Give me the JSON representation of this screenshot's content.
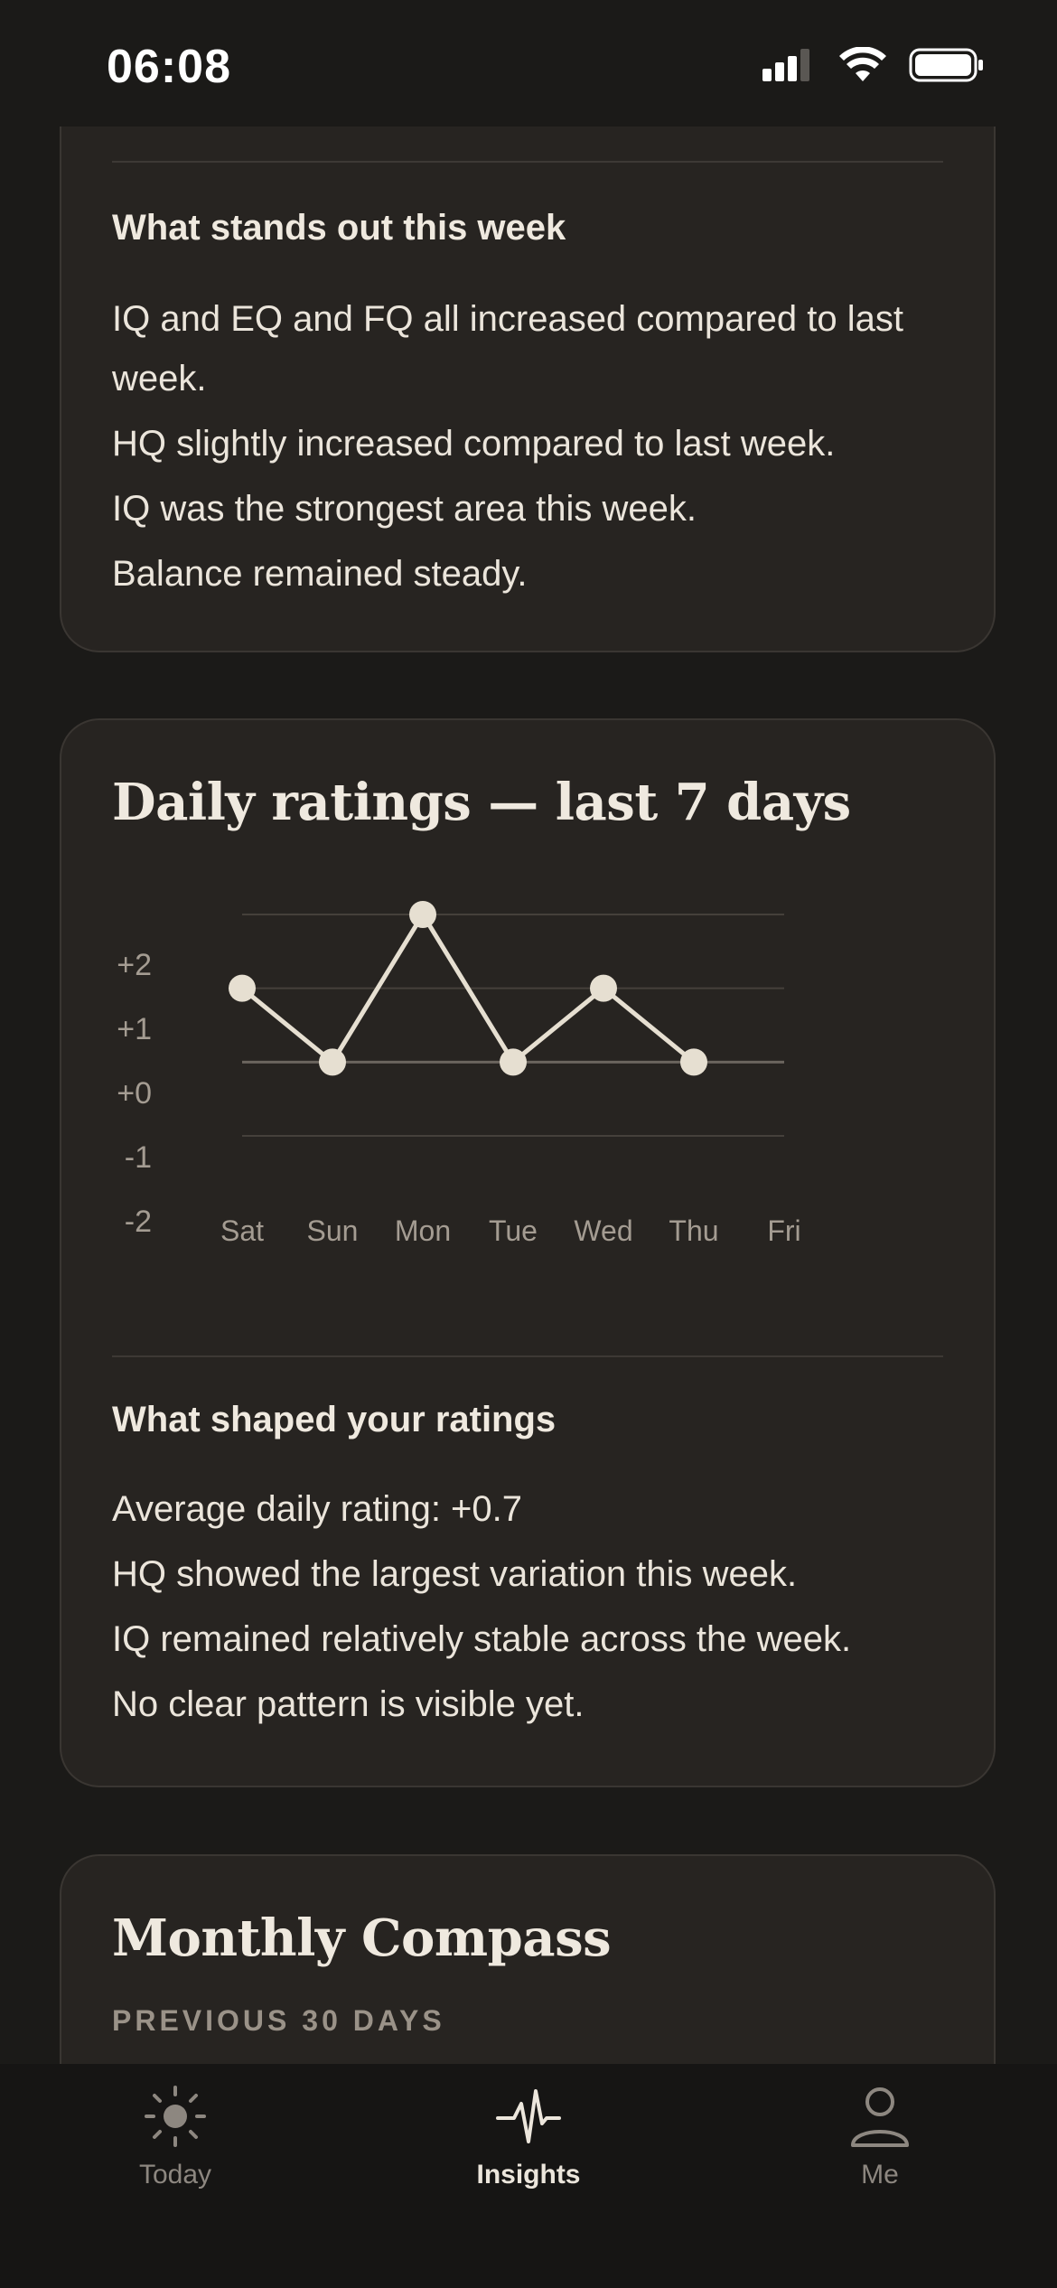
{
  "status_bar": {
    "time": "06:08"
  },
  "week_card": {
    "heading": "What stands out this week",
    "lines": [
      "IQ and EQ and FQ all increased compared to last week.",
      "HQ slightly increased compared to last week.",
      "IQ was the strongest area this week.",
      "Balance remained steady."
    ]
  },
  "ratings_card": {
    "title": "Daily ratings — last 7 days",
    "shaped_heading": "What shaped your ratings",
    "shaped_lines": [
      "Average daily rating: +0.7",
      "HQ showed the largest variation this week.",
      "IQ remained relatively stable across the week.",
      "No clear pattern is visible yet."
    ]
  },
  "chart_data": {
    "type": "line",
    "categories": [
      "Sat",
      "Sun",
      "Mon",
      "Tue",
      "Wed",
      "Thu",
      "Fri"
    ],
    "series": [
      {
        "values": [
          1,
          0,
          2,
          0,
          1,
          0,
          null
        ]
      }
    ],
    "y_tick_labels": [
      "+2",
      "+1",
      "+0",
      "-1",
      "-2"
    ],
    "ylim": [
      -2,
      2
    ],
    "grid": true,
    "line_color": "#e6dfd1"
  },
  "monthly_card": {
    "title": "Monthly Compass",
    "period_label": "PREVIOUS 30 DAYS"
  },
  "tab_bar": {
    "tabs": [
      {
        "label": "Today",
        "icon": "sun-icon",
        "active": false
      },
      {
        "label": "Insights",
        "icon": "pulse-icon",
        "active": true
      },
      {
        "label": "Me",
        "icon": "person-icon",
        "active": false
      }
    ]
  },
  "colors": {
    "background": "#1b1a18",
    "card": "#272421",
    "accent": "#e6dfd1",
    "muted": "#8d8780"
  }
}
